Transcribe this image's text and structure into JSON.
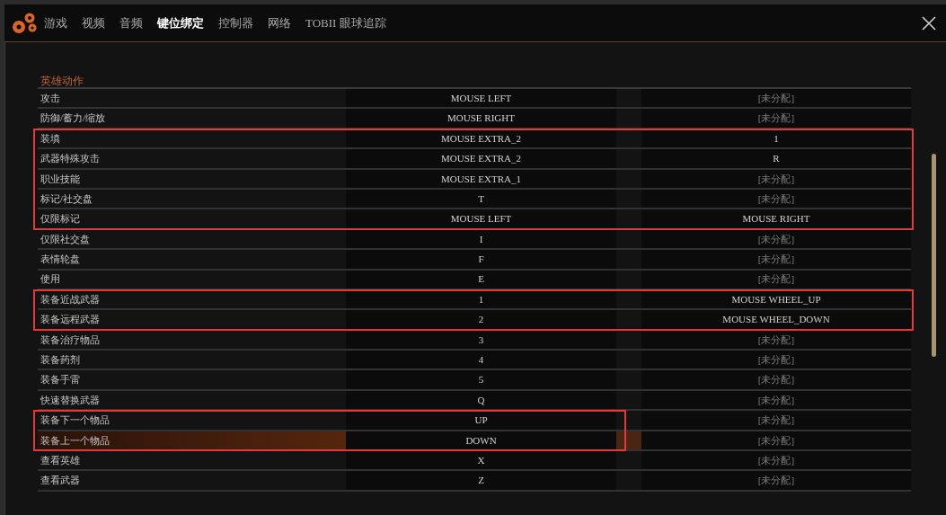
{
  "tabs": [
    {
      "label": "游戏",
      "selected": false
    },
    {
      "label": "视频",
      "selected": false
    },
    {
      "label": "音频",
      "selected": false
    },
    {
      "label": "键位绑定",
      "selected": true
    },
    {
      "label": "控制器",
      "selected": false
    },
    {
      "label": "网络",
      "selected": false
    },
    {
      "label": "TOBII 眼球追踪",
      "selected": false
    }
  ],
  "section_title": "英雄动作",
  "rows": [
    {
      "action": "攻击",
      "primary": "MOUSE LEFT",
      "secondary": "[未分配]",
      "secondary_bound": false,
      "selected": false,
      "outlined": false
    },
    {
      "action": "防御/蓄力/缩放",
      "primary": "MOUSE RIGHT",
      "secondary": "[未分配]",
      "secondary_bound": false,
      "selected": false,
      "outlined": false
    },
    {
      "action": "装填",
      "primary": "MOUSE EXTRA_2",
      "secondary": "1",
      "secondary_bound": true,
      "selected": false,
      "outlined": true,
      "outline_covers_secondary": true
    },
    {
      "action": "武器特殊攻击",
      "primary": "MOUSE EXTRA_2",
      "secondary": "R",
      "secondary_bound": true,
      "selected": false,
      "outlined": true,
      "outline_covers_secondary": true
    },
    {
      "action": "职业技能",
      "primary": "MOUSE EXTRA_1",
      "secondary": "[未分配]",
      "secondary_bound": false,
      "selected": false,
      "outlined": true,
      "outline_covers_secondary": true
    },
    {
      "action": "标记/社交盘",
      "primary": "T",
      "secondary": "[未分配]",
      "secondary_bound": false,
      "selected": false,
      "outlined": true,
      "outline_covers_secondary": true
    },
    {
      "action": "仅限标记",
      "primary": "MOUSE LEFT",
      "secondary": "MOUSE RIGHT",
      "secondary_bound": true,
      "selected": false,
      "outlined": true,
      "outline_covers_secondary": true
    },
    {
      "action": "仅限社交盘",
      "primary": "I",
      "secondary": "[未分配]",
      "secondary_bound": false,
      "selected": false,
      "outlined": false
    },
    {
      "action": "表情轮盘",
      "primary": "F",
      "secondary": "[未分配]",
      "secondary_bound": false,
      "selected": false,
      "outlined": false
    },
    {
      "action": "使用",
      "primary": "E",
      "secondary": "[未分配]",
      "secondary_bound": false,
      "selected": false,
      "outlined": false
    },
    {
      "action": "装备近战武器",
      "primary": "1",
      "secondary": "MOUSE WHEEL_UP",
      "secondary_bound": true,
      "selected": false,
      "outlined": true,
      "outline_covers_secondary": true
    },
    {
      "action": "装备远程武器",
      "primary": "2",
      "secondary": "MOUSE WHEEL_DOWN",
      "secondary_bound": true,
      "selected": false,
      "outlined": true,
      "outline_covers_secondary": true
    },
    {
      "action": "装备治疗物品",
      "primary": "3",
      "secondary": "[未分配]",
      "secondary_bound": false,
      "selected": false,
      "outlined": false
    },
    {
      "action": "装备药剂",
      "primary": "4",
      "secondary": "[未分配]",
      "secondary_bound": false,
      "selected": false,
      "outlined": false
    },
    {
      "action": "装备手雷",
      "primary": "5",
      "secondary": "[未分配]",
      "secondary_bound": false,
      "selected": false,
      "outlined": false
    },
    {
      "action": "快速替换武器",
      "primary": "Q",
      "secondary": "[未分配]",
      "secondary_bound": false,
      "selected": false,
      "outlined": false
    },
    {
      "action": "装备下一个物品",
      "primary": "UP",
      "secondary": "[未分配]",
      "secondary_bound": false,
      "selected": false,
      "outlined": true,
      "outline_covers_secondary": false
    },
    {
      "action": "装备上一个物品",
      "primary": "DOWN",
      "secondary": "[未分配]",
      "secondary_bound": false,
      "selected": true,
      "outlined": true,
      "outline_covers_secondary": false
    },
    {
      "action": "查看英雄",
      "primary": "X",
      "secondary": "[未分配]",
      "secondary_bound": false,
      "selected": false,
      "outlined": false
    },
    {
      "action": "查看武器",
      "primary": "Z",
      "secondary": "[未分配]",
      "secondary_bound": false,
      "selected": false,
      "outlined": false
    }
  ]
}
